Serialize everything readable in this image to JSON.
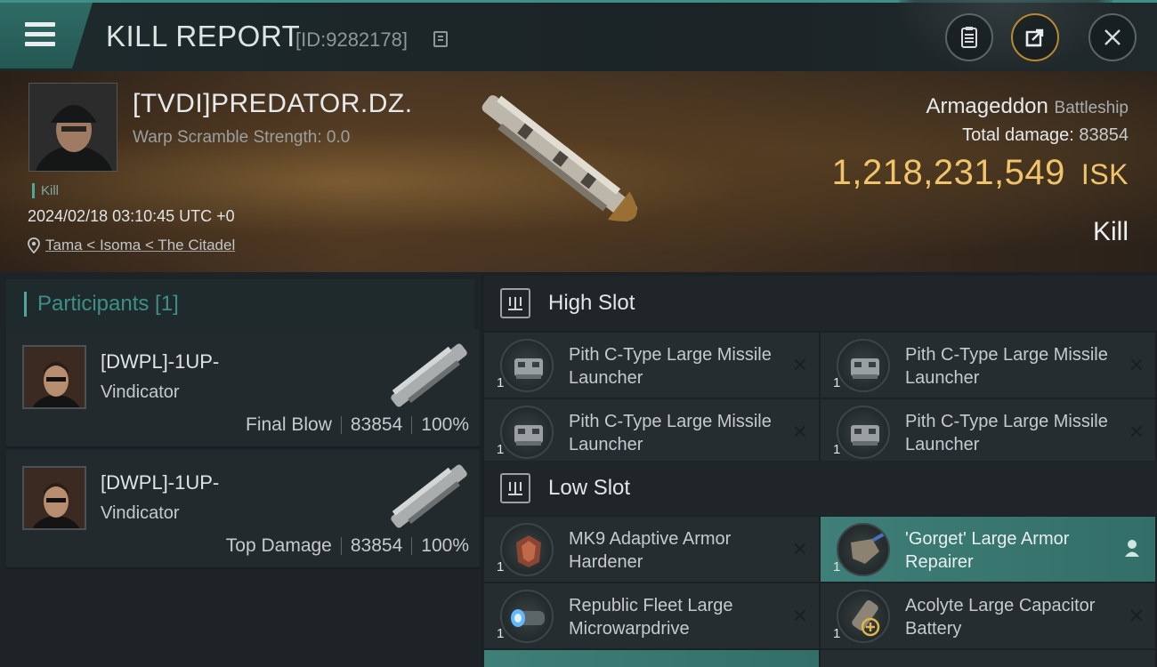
{
  "header": {
    "title": "KILL REPORT",
    "report_id": "[ID:9282178]",
    "menu_icon": "hamburger-menu-icon",
    "actions": [
      {
        "name": "clipboard-icon"
      },
      {
        "name": "share-icon"
      },
      {
        "name": "close-icon"
      }
    ]
  },
  "victim": {
    "name": "[TVDI]PREDATOR.DZ.",
    "warp_scramble": "Warp Scramble Strength: 0.0",
    "tag": "Kill",
    "timestamp": "2024/02/18 03:10:45 UTC +0",
    "location": "Tama < Isoma < The Citadel",
    "ship_name": "Armageddon",
    "ship_class": "Battleship",
    "total_damage_label": "Total damage:",
    "total_damage": "83854",
    "isk_value": "1,218,231,549",
    "isk_unit": "ISK",
    "outcome": "Kill"
  },
  "participants": {
    "title": "Participants [1]",
    "rows": [
      {
        "name": "[DWPL]-1UP-",
        "ship": "Vindicator",
        "role": "Final Blow",
        "damage": "83854",
        "percent": "100%"
      },
      {
        "name": "[DWPL]-1UP-",
        "ship": "Vindicator",
        "role": "Top Damage",
        "damage": "83854",
        "percent": "100%"
      }
    ]
  },
  "slots": {
    "high": {
      "label": "High Slot",
      "modules": [
        {
          "name": "Pith C-Type Large Missile Launcher",
          "qty": "1"
        },
        {
          "name": "Pith C-Type Large Missile Launcher",
          "qty": "1"
        },
        {
          "name": "Pith C-Type Large Missile Launcher",
          "qty": "1"
        },
        {
          "name": "Pith C-Type Large Missile Launcher",
          "qty": "1"
        }
      ]
    },
    "low": {
      "label": "Low Slot",
      "modules": [
        {
          "name": "MK9 Adaptive Armor Hardener",
          "qty": "1"
        },
        {
          "name": "'Gorget' Large Armor Repairer",
          "qty": "1"
        },
        {
          "name": "Republic Fleet Large Microwarpdrive",
          "qty": "1"
        },
        {
          "name": "Acolyte Large Capacitor Battery",
          "qty": "1"
        }
      ]
    }
  },
  "colors": {
    "accent": "#3e8f86",
    "isk": "#f0c46a"
  }
}
